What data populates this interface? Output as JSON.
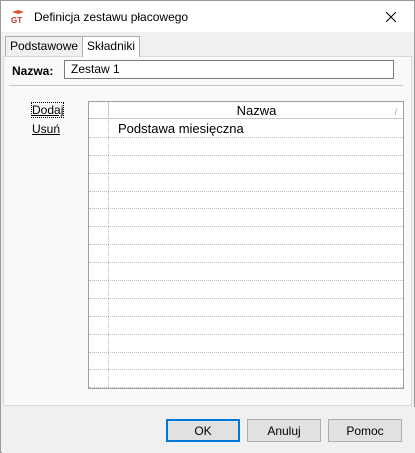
{
  "window": {
    "title": "Definicja zestawu płacowego",
    "icon": "gt-app-icon",
    "close_icon": "close-icon"
  },
  "tabs": [
    {
      "label": "Podstawowe",
      "active": false
    },
    {
      "label": "Składniki",
      "active": true
    }
  ],
  "form": {
    "name_label": "Nazwa:",
    "name_value": "Zestaw 1"
  },
  "actions": {
    "add_label": "Dodaj",
    "remove_label": "Usuń"
  },
  "grid": {
    "column_header": "Nazwa",
    "sort_indicator": "/",
    "rows": [
      "Podstawa miesięczna",
      "",
      "",
      "",
      "",
      "",
      "",
      "",
      "",
      "",
      "",
      "",
      "",
      "",
      ""
    ]
  },
  "buttons": {
    "ok_label": "OK",
    "cancel_label": "Anuluj",
    "help_label": "Pomoc"
  },
  "colors": {
    "default_button_border": "#0078d7",
    "panel_background": "#f0f0f0"
  }
}
